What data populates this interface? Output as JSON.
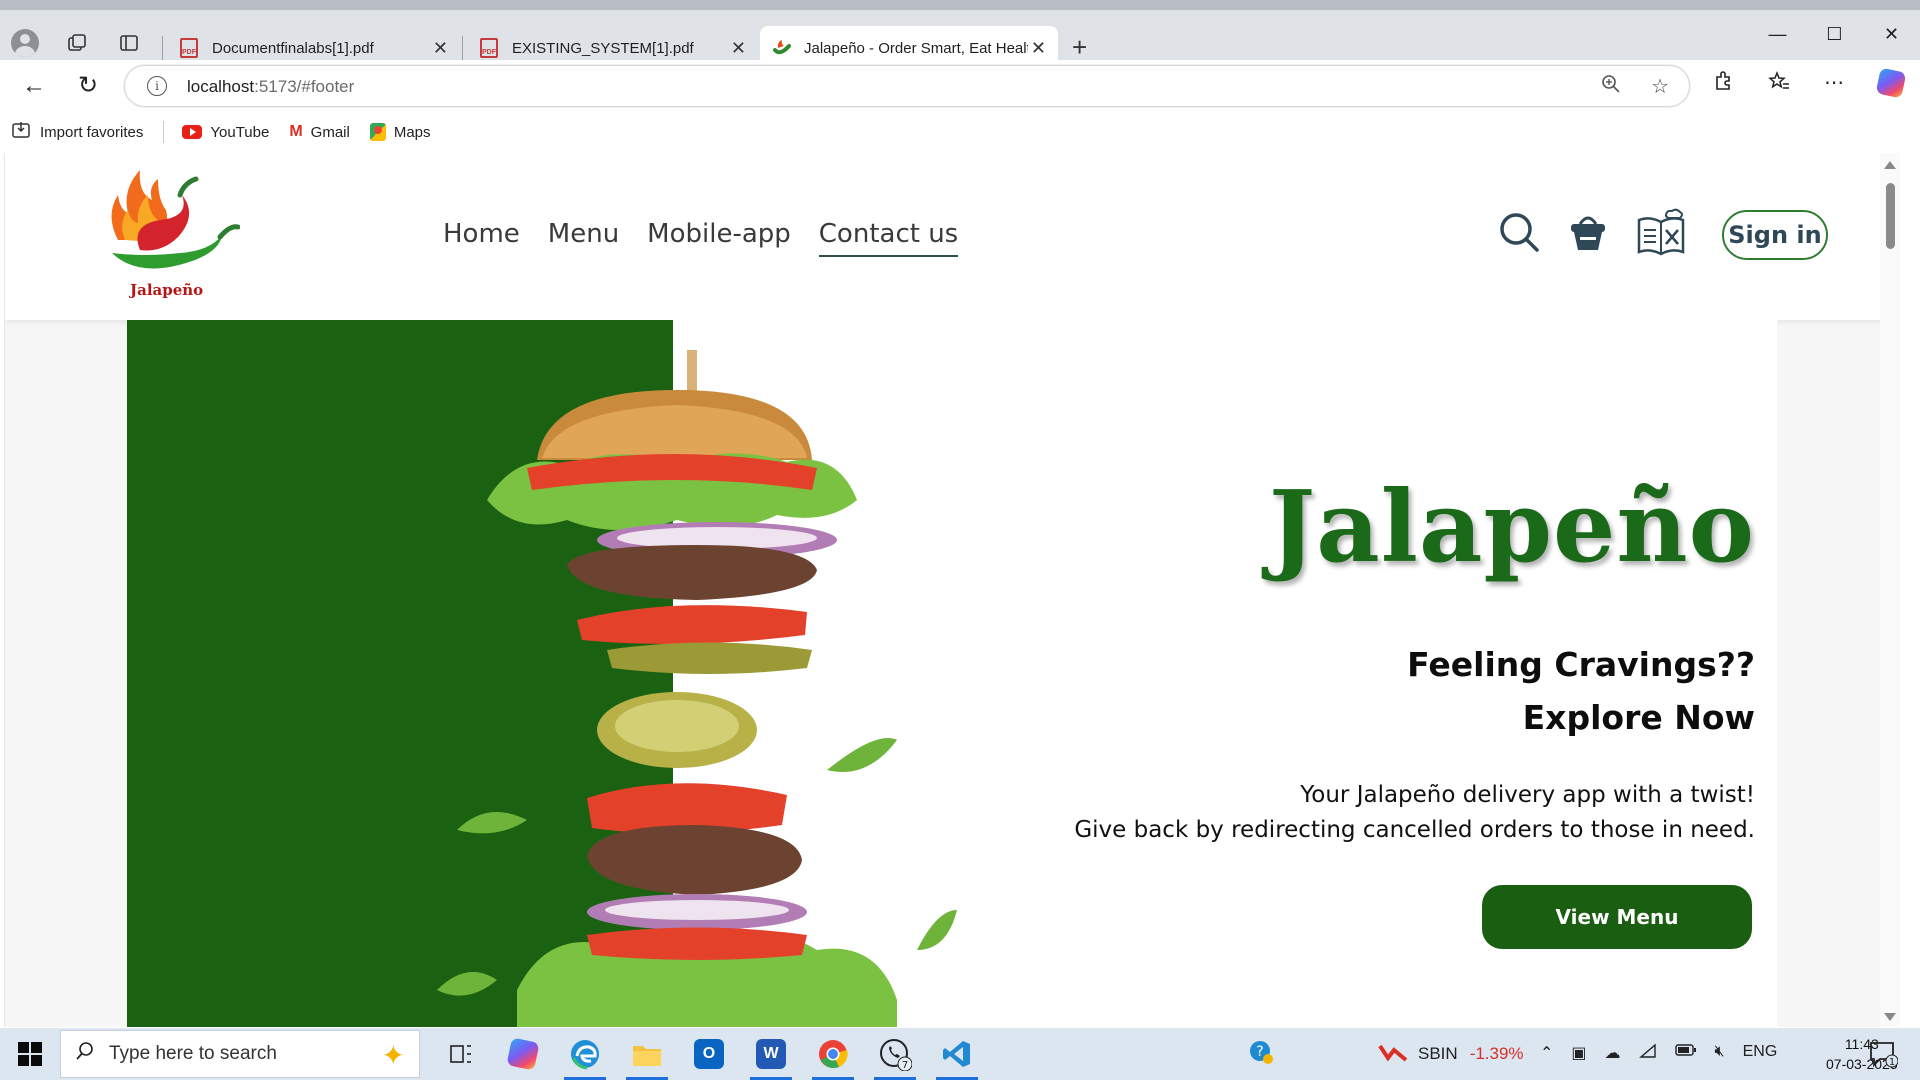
{
  "browser": {
    "tabs": [
      {
        "title": "Documentfinalabs[1].pdf",
        "favicon": "pdf-icon"
      },
      {
        "title": "EXISTING_SYSTEM[1].pdf",
        "favicon": "pdf-icon"
      },
      {
        "title": "Jalapeño - Order Smart, Eat Healt",
        "favicon": "jalapeno-icon",
        "active": true
      }
    ],
    "url_host": "localhost",
    "url_rest": ":5173/#footer",
    "bookmarks": {
      "import": "Import favorites",
      "youtube": "YouTube",
      "gmail": "Gmail",
      "maps": "Maps"
    }
  },
  "site": {
    "logo_text": "Jalapeño",
    "nav": {
      "home": "Home",
      "menu": "Menu",
      "mobile_app": "Mobile-app",
      "contact": "Contact us"
    },
    "active_nav": "Contact us",
    "signin": "Sign in",
    "hero": {
      "title": "Jalapeño",
      "sub_line1": "Feeling Cravings??",
      "sub_line2": "Explore Now",
      "desc_line1": "Your Jalapeño delivery app with a twist!",
      "desc_line2": "Give back by redirecting cancelled orders to those in need.",
      "button": "View Menu"
    },
    "colors": {
      "brand_green": "#1a6212",
      "title_green": "#1b6a1a"
    }
  },
  "taskbar": {
    "search_placeholder": "Type here to search",
    "stock_name": "SBIN",
    "stock_change": "-1.39%",
    "language": "ENG",
    "time": "11:43",
    "date": "07-03-2025",
    "whatsapp_badge": "7",
    "notification_count": "1"
  }
}
